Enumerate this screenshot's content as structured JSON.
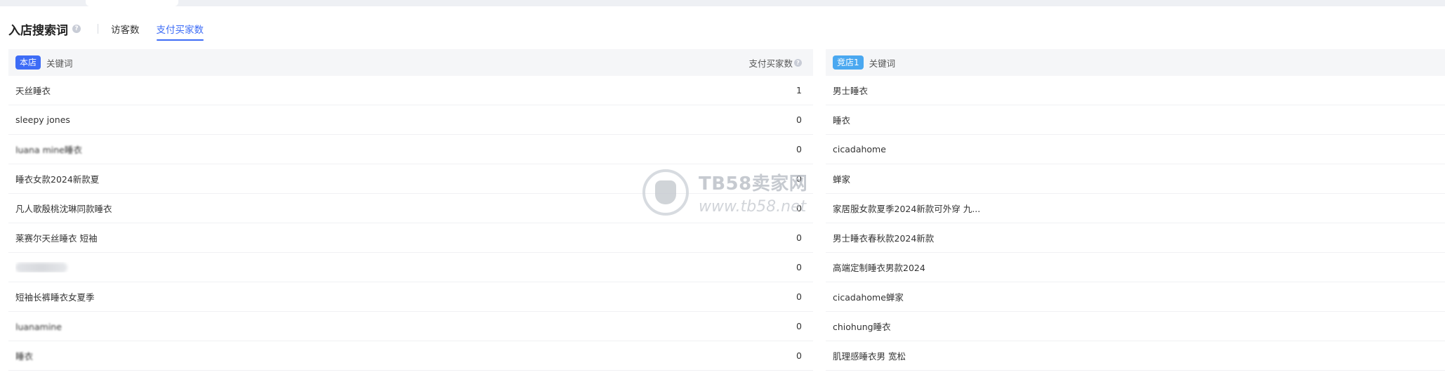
{
  "header": {
    "title": "入店搜索词",
    "tabs": [
      {
        "label": "访客数",
        "active": false
      },
      {
        "label": "支付买家数",
        "active": true
      }
    ]
  },
  "own_panel": {
    "badge": "本店",
    "col_keyword": "关键词",
    "col_value": "支付买家数",
    "rows": [
      {
        "keyword": "天丝睡衣",
        "value": "1"
      },
      {
        "keyword": "sleepy jones",
        "value": "0"
      },
      {
        "keyword": "luana mine睡衣",
        "value": "0"
      },
      {
        "keyword": "睡衣女款2024新款夏",
        "value": "0"
      },
      {
        "keyword": "凡人歌殷桃沈琳同款睡衣",
        "value": "0"
      },
      {
        "keyword": "莱赛尔天丝睡衣 短袖",
        "value": "0"
      },
      {
        "keyword": "",
        "value": "0"
      },
      {
        "keyword": "短袖长裤睡衣女夏季",
        "value": "0"
      },
      {
        "keyword": "luanamine",
        "value": "0"
      },
      {
        "keyword": "睡衣",
        "value": "0"
      }
    ]
  },
  "rival_panel": {
    "badge": "竞店1",
    "col_keyword": "关键词",
    "rows": [
      {
        "keyword": "男士睡衣"
      },
      {
        "keyword": "睡衣"
      },
      {
        "keyword": "cicadahome"
      },
      {
        "keyword": "蝉家"
      },
      {
        "keyword": "家居服女款夏季2024新款可外穿 九..."
      },
      {
        "keyword": "男士睡衣春秋款2024新款"
      },
      {
        "keyword": "高端定制睡衣男款2024"
      },
      {
        "keyword": "cicadahome蝉家"
      },
      {
        "keyword": "chiohung睡衣"
      },
      {
        "keyword": "肌理感睡衣男 宽松"
      }
    ]
  },
  "watermark": {
    "brand": "TB58卖家网",
    "url": "www.tb58.net"
  },
  "colors": {
    "accent": "#3d6cf6",
    "rival_badge": "#4aa8f0",
    "header_bg": "#f5f6f8"
  }
}
